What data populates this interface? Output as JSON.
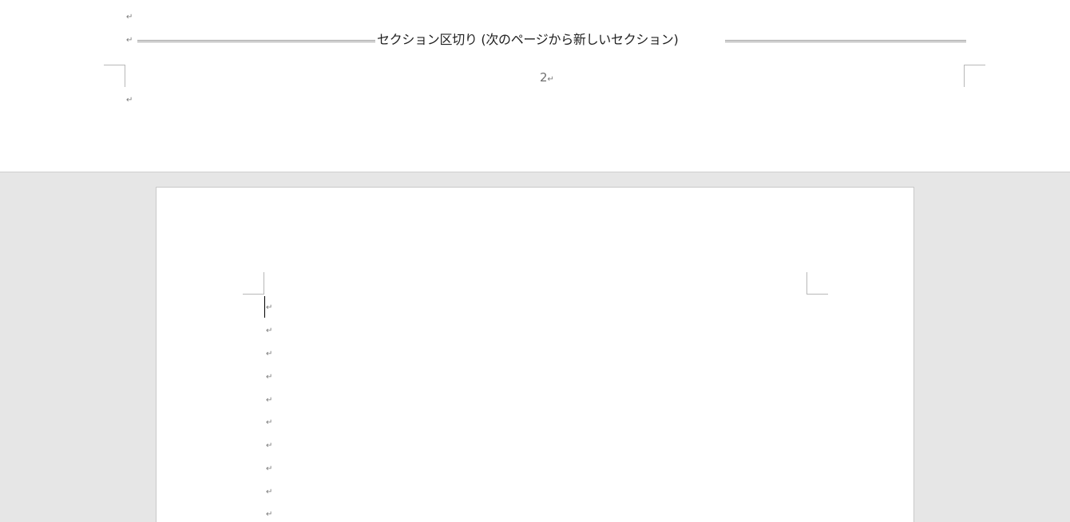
{
  "previous_page": {
    "paragraph_marks": [
      "↵",
      "↵",
      "↵"
    ],
    "section_break_label": "セクション区切り (次のページから新しいセクション)",
    "page_number": "2",
    "page_number_mark": "↵"
  },
  "current_page": {
    "paragraph_marks": [
      "↵",
      "↵",
      "↵",
      "↵",
      "↵",
      "↵",
      "↵",
      "↵",
      "↵",
      "↵"
    ]
  }
}
